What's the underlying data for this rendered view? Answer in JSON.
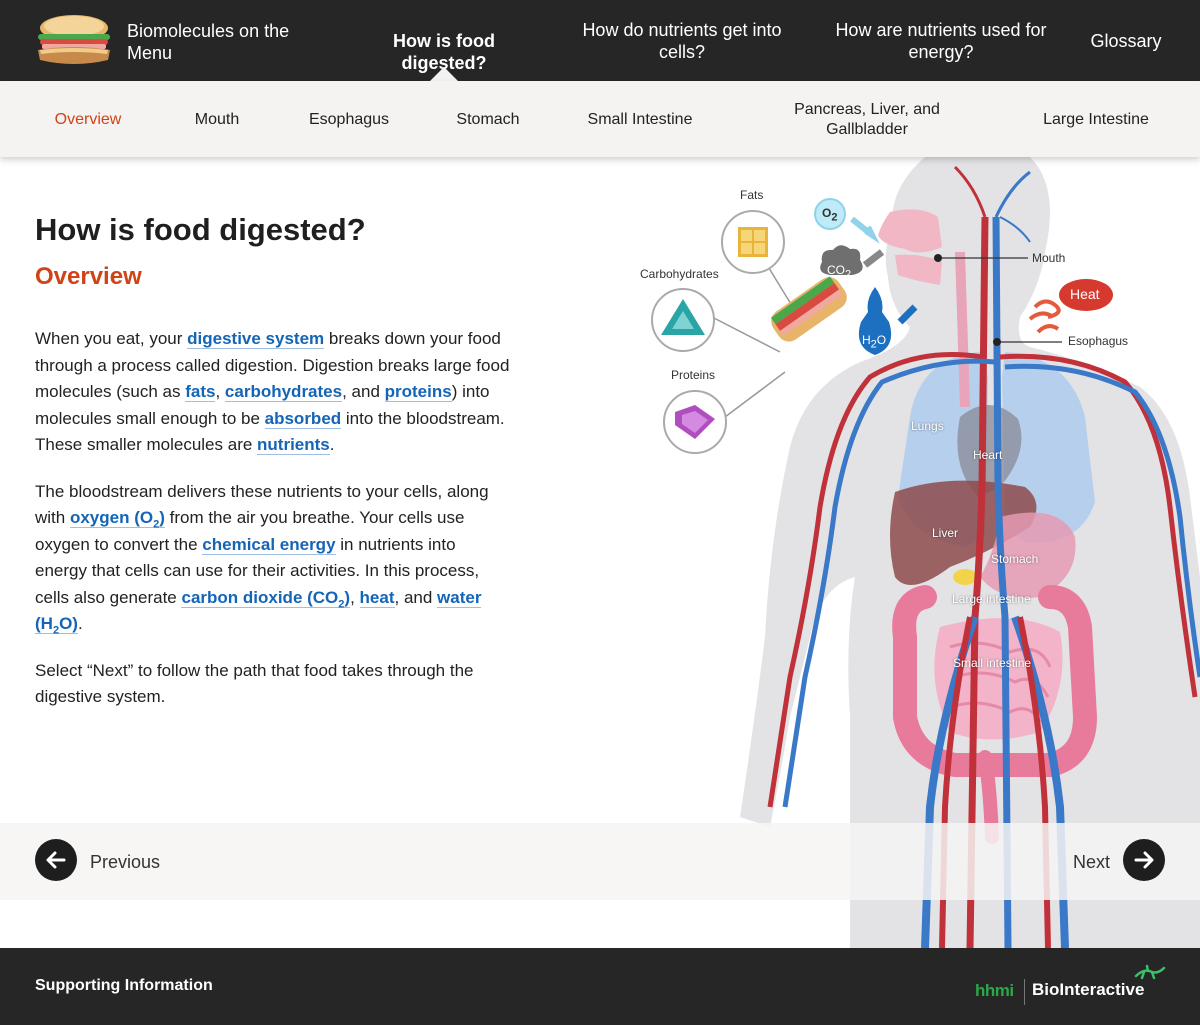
{
  "header": {
    "app_title": "Biomolecules on the Menu",
    "nav": [
      {
        "label": "How is food digested?",
        "active": true
      },
      {
        "label": "How do nutrients get into cells?",
        "active": false
      },
      {
        "label": "How are nutrients used for energy?",
        "active": false
      },
      {
        "label": "Glossary",
        "active": false
      }
    ]
  },
  "subnav": [
    {
      "label": "Overview",
      "active": true
    },
    {
      "label": "Mouth",
      "active": false
    },
    {
      "label": "Esophagus",
      "active": false
    },
    {
      "label": "Stomach",
      "active": false
    },
    {
      "label": "Small Intestine",
      "active": false
    },
    {
      "label": "Pancreas, Liver, and Gallbladder",
      "active": false
    },
    {
      "label": "Large Intestine",
      "active": false
    }
  ],
  "main": {
    "title": "How is food digested?",
    "section": "Overview",
    "p1": {
      "t1": "When you eat, your ",
      "l1": "digestive system",
      "t2": " breaks down your food through a process called digestion. Digestion breaks large food molecules (such as ",
      "l2": "fats",
      "t3": ", ",
      "l3": "carbohydrates",
      "t4": ", and ",
      "l4": "proteins",
      "t5": ") into molecules small enough to be ",
      "l5": "absorbed",
      "t6": " into the bloodstream. These smaller molecules are ",
      "l6": "nutrients",
      "t7": "."
    },
    "p2": {
      "t1": "The bloodstream delivers these nutrients to your cells, along with ",
      "l1": "oxygen (O",
      "l1_sub": "2",
      "l1_end": ")",
      "t2": " from the air you breathe. Your cells use oxygen to convert the ",
      "l2": "chemical energy",
      "t3": " in nutrients into energy that cells can use for their activities. In this process, cells also generate ",
      "l3": "carbon dioxide (CO",
      "l3_sub": "2",
      "l3_end": ")",
      "t4": ", ",
      "l4": "heat",
      "t5": ", and ",
      "l5": "water",
      "l6": "(H",
      "l6_sub": "2",
      "l6_end": "O)",
      "t6": "."
    },
    "p3": "Select “Next” to follow the path that food takes through the digestive system."
  },
  "illustration": {
    "labels": {
      "fats": "Fats",
      "carbohydrates": "Carbohydrates",
      "proteins": "Proteins",
      "o2": "O",
      "o2_sub": "2",
      "co2": "CO",
      "co2_sub": "2",
      "h2o_a": "H",
      "h2o_sub": "2",
      "h2o_b": "O",
      "heat": "Heat",
      "mouth": "Mouth",
      "esophagus": "Esophagus",
      "lungs": "Lungs",
      "heart": "Heart",
      "liver": "Liver",
      "stomach": "Stomach",
      "large_intestine": "Large intestine",
      "small_intestine": "Small intestine"
    },
    "colors": {
      "body": "#e2e2e4",
      "artery": "#c0313a",
      "vein": "#3a78c8",
      "lungs": "#a9c9ef",
      "intestine": "#e87b9c",
      "liver": "#8e4b4b"
    }
  },
  "pager": {
    "previous": "Previous",
    "next": "Next"
  },
  "footer": {
    "link": "Supporting Information",
    "brand_a": "hhmi",
    "brand_b": "BioInteractive"
  }
}
